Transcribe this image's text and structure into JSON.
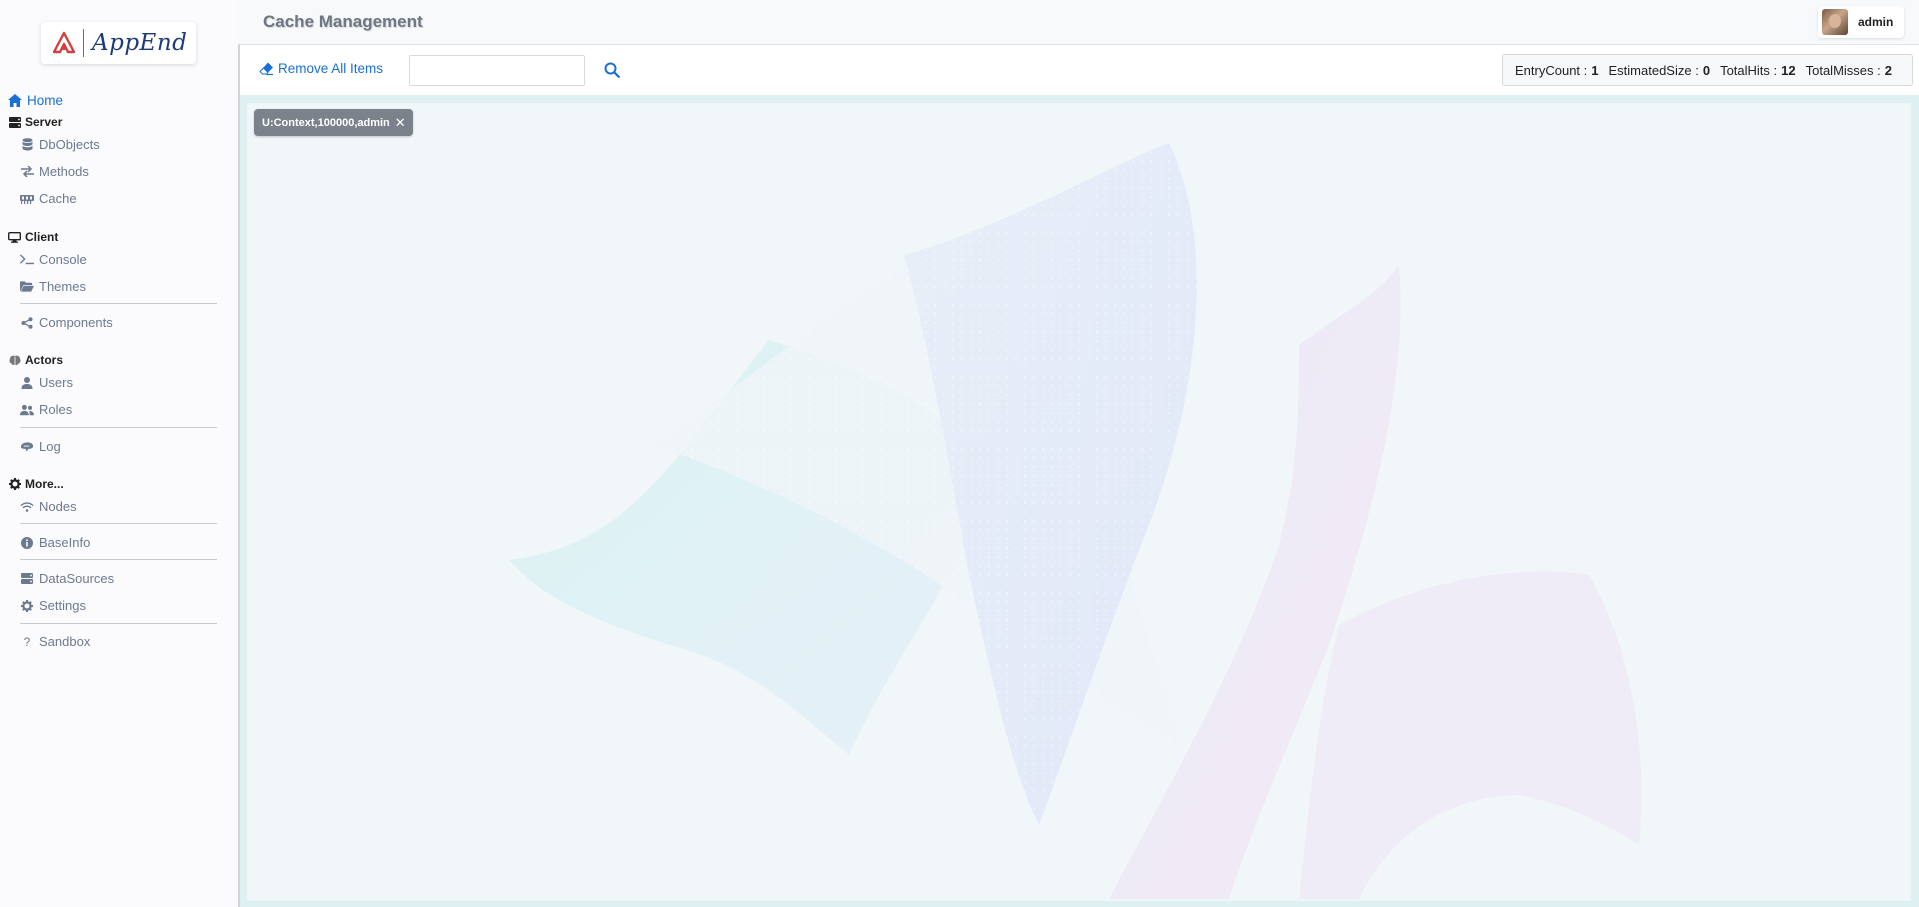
{
  "app": {
    "logo_text": "AppEnd",
    "page_title": "Cache Management"
  },
  "user": {
    "name": "admin"
  },
  "sidebar": {
    "home": "Home",
    "sections": [
      {
        "title": "Server",
        "items": [
          "DbObjects",
          "Methods",
          "Cache"
        ]
      },
      {
        "title": "Client",
        "items": [
          "Console",
          "Themes",
          "Components"
        ]
      },
      {
        "title": "Actors",
        "items": [
          "Users",
          "Roles",
          "Log"
        ]
      },
      {
        "title": "More...",
        "items": [
          "Nodes",
          "BaseInfo",
          "DataSources",
          "Settings",
          "Sandbox"
        ]
      }
    ]
  },
  "toolbar": {
    "remove_all_label": "Remove All Items",
    "search_value": "",
    "search_placeholder": ""
  },
  "stats": {
    "entry_count_label": "EntryCount :",
    "entry_count": "1",
    "estimated_size_label": "EstimatedSize :",
    "estimated_size": "0",
    "total_hits_label": "TotalHits :",
    "total_hits": "12",
    "total_misses_label": "TotalMisses :",
    "total_misses": "2"
  },
  "cache_items": [
    {
      "key": "U:Context,100000,admin"
    }
  ],
  "colors": {
    "accent": "#1a6fd6",
    "tag_bg": "#7b828c",
    "logo_red": "#d04040",
    "logo_blue": "#1d3a7a"
  }
}
